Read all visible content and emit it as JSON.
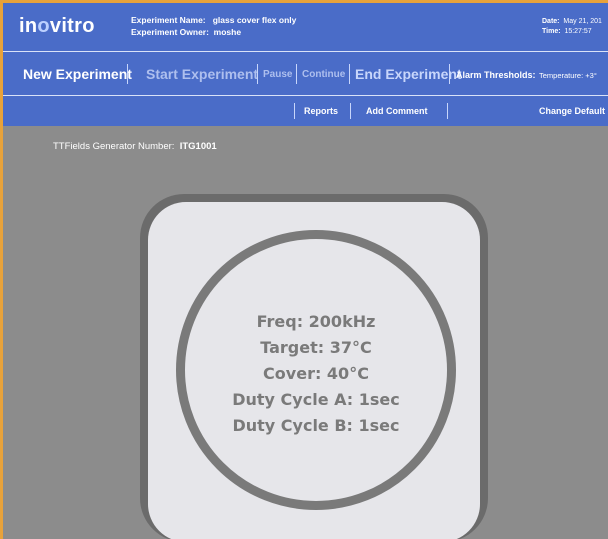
{
  "header": {
    "logo_prefix": "in",
    "logo_highlight": "o",
    "logo_suffix": "vitro",
    "experiment_name_label": "Experiment Name:",
    "experiment_name_value": "glass cover flex only",
    "experiment_owner_label": "Experiment Owner:",
    "experiment_owner_value": "moshe",
    "date_label": "Date:",
    "date_value": "May 21, 201",
    "time_label": "Time:",
    "time_value": "15:27:57"
  },
  "toolbar": {
    "new_experiment": "New Experiment",
    "start_experiment": "Start Experiment",
    "pause": "Pause",
    "continue": "Continue",
    "end_experiment": "End Experiment",
    "alarm_thresholds": "Alarm Thresholds:",
    "temperature": "Temperature:  +3°"
  },
  "subbar": {
    "reports": "Reports",
    "add_comment": "Add Comment",
    "change_default": "Change Default"
  },
  "main": {
    "generator_label": "TTFields Generator Number:",
    "generator_value": "ITG1001",
    "readouts": {
      "freq": "Freq:  200kHz",
      "target": "Target:     37°C",
      "cover": "Cover:     40°C",
      "duty_a": "Duty Cycle A:  1sec",
      "duty_b": "Duty Cycle B:  1sec"
    }
  },
  "colors": {
    "accent_border": "#e8a23a",
    "header_blue": "#4a6cc8",
    "background_gray": "#8c8c8c"
  }
}
